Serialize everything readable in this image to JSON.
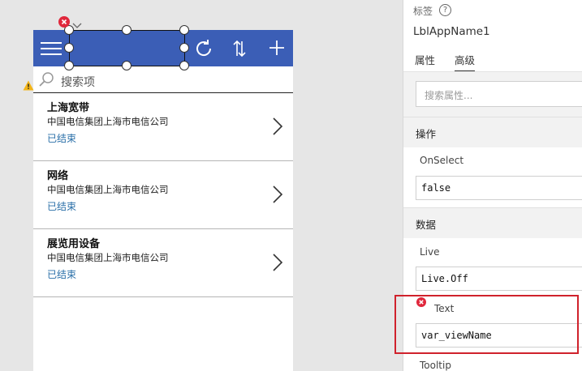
{
  "app": {
    "search_placeholder": "搜索项",
    "items": [
      {
        "title": "上海宽带",
        "subtitle": "中国电信集团上海市电信公司",
        "status": "已结束"
      },
      {
        "title": "网络",
        "subtitle": "中国电信集团上海市电信公司",
        "status": "已结束"
      },
      {
        "title": "展览用设备",
        "subtitle": "中国电信集团上海市电信公司",
        "status": "已结束"
      }
    ]
  },
  "panel": {
    "label": "标签",
    "help_glyph": "?",
    "control_name": "LblAppName1",
    "tabs": [
      "属性",
      "高级"
    ],
    "search_placeholder": "搜索属性...",
    "sections": {
      "actions": "操作",
      "data": "数据"
    },
    "properties": {
      "onselect": {
        "name": "OnSelect",
        "value": "false"
      },
      "live": {
        "name": "Live",
        "value": "Live.Off"
      },
      "text": {
        "name": "Text",
        "value": "var_viewName"
      },
      "tooltip": {
        "name": "Tooltip"
      }
    }
  },
  "colors": {
    "header": "#3b5eb6",
    "status_text": "#2a6fa8",
    "error": "#e0283c",
    "highlight": "#d0222c"
  }
}
